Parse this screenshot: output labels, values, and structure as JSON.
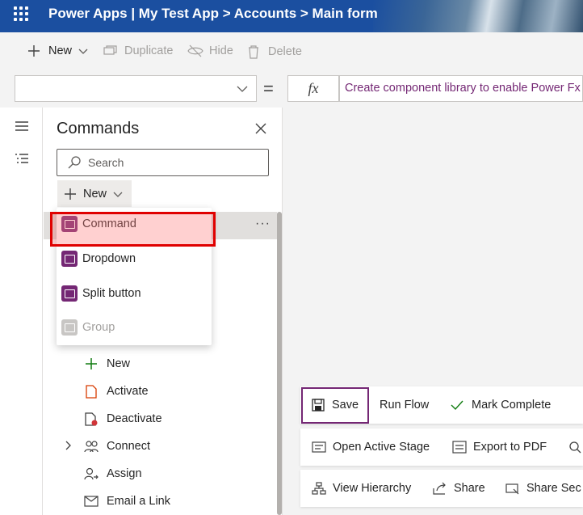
{
  "header": {
    "title": "Power Apps  |  My Test App > Accounts > Main form"
  },
  "command_bar": {
    "new": "New",
    "duplicate": "Duplicate",
    "hide": "Hide",
    "delete": "Delete"
  },
  "formula_bar": {
    "property_value": "",
    "equals": "=",
    "fx": "fx",
    "formula_text": "Create component library to enable Power Fx"
  },
  "panel": {
    "title": "Commands",
    "search_placeholder": "Search",
    "new_label": "New",
    "popup_items": [
      {
        "label": "Command",
        "icon": "command-icon",
        "selected": true
      },
      {
        "label": "Dropdown",
        "icon": "dropdown-icon"
      },
      {
        "label": "Split button",
        "icon": "split-button-icon"
      },
      {
        "label": "Group",
        "icon": "group-icon",
        "disabled": true
      }
    ],
    "tree_items": [
      {
        "label": "New",
        "icon": "plus-icon"
      },
      {
        "label": "Activate",
        "icon": "activate-icon"
      },
      {
        "label": "Deactivate",
        "icon": "deactivate-icon"
      },
      {
        "label": "Connect",
        "icon": "connect-icon"
      },
      {
        "label": "Assign",
        "icon": "assign-icon"
      },
      {
        "label": "Email a Link",
        "icon": "email-link-icon"
      }
    ],
    "more_options": "···"
  },
  "form_commands": {
    "row1": [
      "Save",
      "Run Flow",
      "Mark Complete"
    ],
    "row2": [
      "Open Active Stage",
      "Export to PDF"
    ],
    "row3": [
      "View Hierarchy",
      "Share",
      "Share Sec"
    ]
  },
  "colors": {
    "accent": "#742774",
    "header": "#1b4fa0",
    "highlight": "#ffcccc",
    "highlight_border": "#e00000"
  }
}
